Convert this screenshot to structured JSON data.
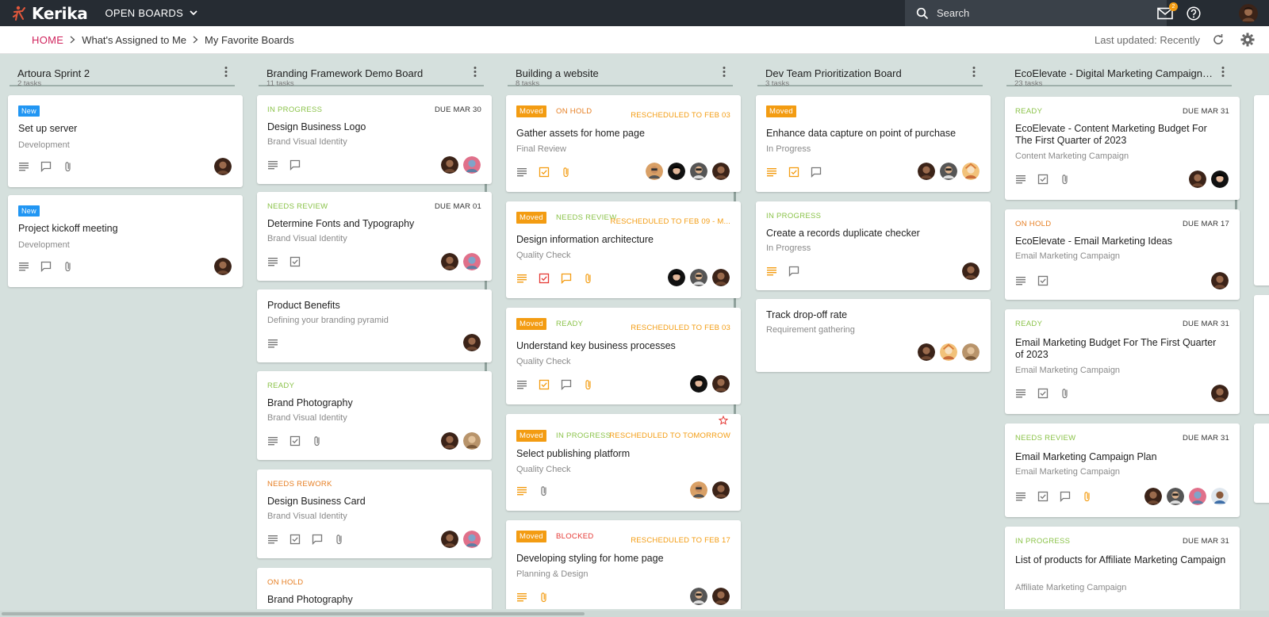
{
  "app": {
    "name": "Kerika",
    "open_boards_label": "OPEN BOARDS",
    "search_placeholder": "Search",
    "notification_count": "2",
    "colors": {
      "topbar": "#262c33",
      "accent": "#d0245d",
      "new_tag": "#2196f3",
      "moved_tag": "#f39c12"
    }
  },
  "breadcrumb": {
    "home": "HOME",
    "items": [
      "What's Assigned to Me",
      "My Favorite Boards"
    ],
    "last_updated": "Last updated: Recently"
  },
  "columns": [
    {
      "title": "Artoura Sprint 2",
      "count": "2 tasks",
      "cards": [
        {
          "tag": "New",
          "title": "Set up server",
          "sub": "Development"
        },
        {
          "tag": "New",
          "title": "Project kickoff meeting",
          "sub": "Development"
        }
      ]
    },
    {
      "title": "Branding Framework Demo Board",
      "count": "11 tasks",
      "cards": [
        {
          "status": "IN PROGRESS",
          "due": "DUE MAR 30",
          "title": "Design Business Logo",
          "sub": "Brand Visual Identity"
        },
        {
          "status": "NEEDS REVIEW",
          "due": "DUE MAR 01",
          "title": "Determine Fonts and Typography",
          "sub": "Brand Visual Identity"
        },
        {
          "title": "Product Benefits",
          "sub": "Defining your branding pyramid"
        },
        {
          "status": "READY",
          "title": "Brand Photography",
          "sub": "Brand Visual Identity"
        },
        {
          "status": "NEEDS REWORK",
          "title": "Design Business Card",
          "sub": "Brand Visual Identity"
        },
        {
          "status": "ON HOLD",
          "title": "Brand Photography"
        }
      ]
    },
    {
      "title": "Building a website",
      "count": "8 tasks",
      "cards": [
        {
          "tag": "Moved",
          "status": "ON HOLD",
          "resched": "RESCHEDULED TO FEB 03",
          "title": "Gather assets for home page",
          "sub": "Final Review"
        },
        {
          "tag": "Moved",
          "status": "NEEDS REVIEW",
          "resched": "RESCHEDULED TO FEB 09 - M...",
          "title": "Design information architecture",
          "sub": "Quality Check"
        },
        {
          "tag": "Moved",
          "status": "READY",
          "resched": "RESCHEDULED TO FEB 03",
          "title": "Understand key business processes",
          "sub": "Quality Check"
        },
        {
          "tag": "Moved",
          "status": "IN PROGRESS",
          "resched": "RESCHEDULED TO TOMORROW",
          "title": "Select publishing platform",
          "sub": "Quality Check"
        },
        {
          "tag": "Moved",
          "status": "BLOCKED",
          "resched": "RESCHEDULED TO FEB 17",
          "title": "Developing styling for home page",
          "sub": "Planning & Design"
        }
      ]
    },
    {
      "title": "Dev Team Prioritization Board",
      "count": "3 tasks",
      "cards": [
        {
          "tag": "Moved",
          "title": "Enhance data capture on point of purchase",
          "sub": "In Progress"
        },
        {
          "status": "IN PROGRESS",
          "title": "Create a records duplicate checker",
          "sub": "In Progress"
        },
        {
          "title": "Track drop-off rate",
          "sub": "Requirement gathering"
        }
      ]
    },
    {
      "title": "EcoElevate - Digital Marketing Campaign ...",
      "count": "23 tasks",
      "cards": [
        {
          "status": "READY",
          "due": "DUE MAR 31",
          "title": "EcoElevate - Content Marketing Budget For The First Quarter of 2023",
          "sub": "Content Marketing Campaign"
        },
        {
          "status": "ON HOLD",
          "due": "DUE MAR 17",
          "title": "EcoElevate - Email Marketing Ideas",
          "sub": "Email Marketing Campaign"
        },
        {
          "status": "READY",
          "due": "DUE MAR 31",
          "title": "Email Marketing Budget For The First Quarter of 2023",
          "sub": "Email Marketing Campaign"
        },
        {
          "status": "NEEDS REVIEW",
          "due": "DUE MAR 31",
          "title": "Email Marketing Campaign Plan",
          "sub": "Email Marketing Campaign"
        },
        {
          "status": "IN PROGRESS",
          "due": "DUE MAR 31",
          "title": "List of products for Affiliate Marketing Campaign",
          "sub": "Affiliate Marketing Campaign"
        }
      ]
    }
  ]
}
